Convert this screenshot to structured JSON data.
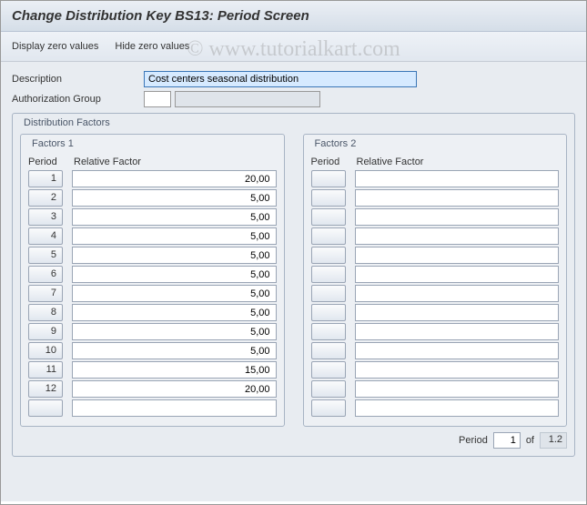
{
  "title": "Change Distribution Key BS13: Period Screen",
  "watermark": "© www.tutorialkart.com",
  "toolbar": {
    "display_zero": "Display zero values",
    "hide_zero": "Hide zero values"
  },
  "fields": {
    "description_label": "Description",
    "description_value": "Cost centers seasonal distribution",
    "auth_group_label": "Authorization Group",
    "auth_group_value1": "",
    "auth_group_value2": ""
  },
  "distribution": {
    "title": "Distribution Factors",
    "factors1": {
      "title": "Factors 1",
      "header_period": "Period",
      "header_factor": "Relative Factor",
      "rows": [
        {
          "period": "1",
          "factor": "20,00"
        },
        {
          "period": "2",
          "factor": "5,00"
        },
        {
          "period": "3",
          "factor": "5,00"
        },
        {
          "period": "4",
          "factor": "5,00"
        },
        {
          "period": "5",
          "factor": "5,00"
        },
        {
          "period": "6",
          "factor": "5,00"
        },
        {
          "period": "7",
          "factor": "5,00"
        },
        {
          "period": "8",
          "factor": "5,00"
        },
        {
          "period": "9",
          "factor": "5,00"
        },
        {
          "period": "10",
          "factor": "5,00"
        },
        {
          "period": "11",
          "factor": "15,00"
        },
        {
          "period": "12",
          "factor": "20,00"
        },
        {
          "period": "",
          "factor": ""
        }
      ]
    },
    "factors2": {
      "title": "Factors 2",
      "header_period": "Period",
      "header_factor": "Relative Factor",
      "rows": [
        {
          "period": "",
          "factor": ""
        },
        {
          "period": "",
          "factor": ""
        },
        {
          "period": "",
          "factor": ""
        },
        {
          "period": "",
          "factor": ""
        },
        {
          "period": "",
          "factor": ""
        },
        {
          "period": "",
          "factor": ""
        },
        {
          "period": "",
          "factor": ""
        },
        {
          "period": "",
          "factor": ""
        },
        {
          "period": "",
          "factor": ""
        },
        {
          "period": "",
          "factor": ""
        },
        {
          "period": "",
          "factor": ""
        },
        {
          "period": "",
          "factor": ""
        },
        {
          "period": "",
          "factor": ""
        }
      ]
    }
  },
  "pager": {
    "label": "Period",
    "current": "1",
    "of_label": "of",
    "total": "1.2"
  }
}
